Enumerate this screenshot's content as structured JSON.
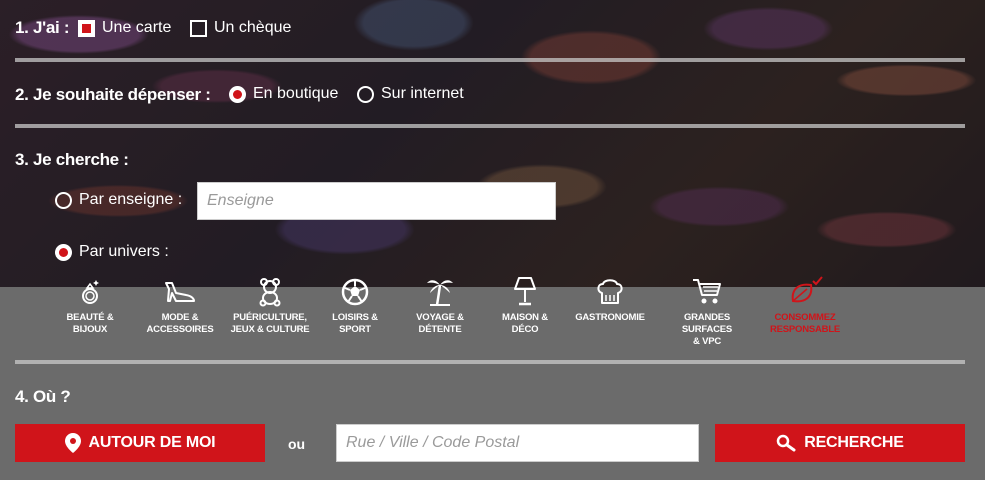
{
  "section1": {
    "title": "1. J'ai :",
    "options": [
      {
        "label": "Une carte",
        "checked": true
      },
      {
        "label": "Un chèque",
        "checked": false
      }
    ]
  },
  "section2": {
    "title": "2. Je souhaite dépenser :",
    "options": [
      {
        "label": "En boutique",
        "checked": true
      },
      {
        "label": "Sur internet",
        "checked": false
      }
    ]
  },
  "section3": {
    "title": "3. Je cherche :",
    "by_brand_label": "Par enseigne :",
    "by_brand_checked": false,
    "brand_placeholder": "Enseigne",
    "by_universe_label": "Par univers :",
    "by_universe_checked": true,
    "categories": [
      {
        "line1": "BEAUTÉ &",
        "line2": "BIJOUX",
        "icon": "ring-icon"
      },
      {
        "line1": "MODE &",
        "line2": "ACCESSOIRES",
        "icon": "high-heel-icon"
      },
      {
        "line1": "PUÉRICULTURE,",
        "line2": "JEUX & CULTURE",
        "icon": "teddy-bear-icon"
      },
      {
        "line1": "LOISIRS &",
        "line2": "SPORT",
        "icon": "ball-icon"
      },
      {
        "line1": "VOYAGE &",
        "line2": "DÉTENTE",
        "icon": "palm-tree-icon"
      },
      {
        "line1": "MAISON &",
        "line2": "DÉCO",
        "icon": "lamp-icon"
      },
      {
        "line1": "GASTRONOMIE",
        "line2": "",
        "icon": "chef-hat-icon"
      },
      {
        "line1": "GRANDES SURFACES",
        "line2": "& VPC",
        "icon": "shopping-cart-icon"
      },
      {
        "line1": "CONSOMMEZ",
        "line2": "RESPONSABLE",
        "icon": "leaf-check-icon"
      }
    ]
  },
  "section4": {
    "title": "4. Où ?",
    "around_me_label": "AUTOUR DE MOI",
    "or_label": "ou",
    "address_placeholder": "Rue / Ville / Code Postal",
    "search_label": "RECHERCHE"
  },
  "colors": {
    "accent": "#d0141a",
    "panel": "#6b6b6b"
  }
}
